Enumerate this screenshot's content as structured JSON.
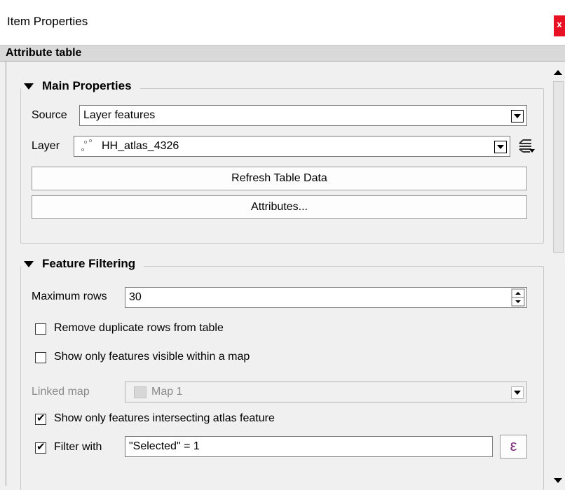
{
  "window": {
    "title": "Item Properties",
    "close_glyph": "x"
  },
  "section_header": "Attribute table",
  "main_properties": {
    "title": "Main Properties",
    "source_label": "Source",
    "source_value": "Layer features",
    "layer_label": "Layer",
    "layer_value": "HH_atlas_4326",
    "refresh_button": "Refresh Table Data",
    "attributes_button": "Attributes..."
  },
  "feature_filtering": {
    "title": "Feature Filtering",
    "max_rows_label": "Maximum rows",
    "max_rows_value": "30",
    "remove_duplicates_label": "Remove duplicate rows from table",
    "remove_duplicates_checked": false,
    "visible_in_map_label": "Show only features visible within a map",
    "visible_in_map_checked": false,
    "linked_map_label": "Linked map",
    "linked_map_value": "Map 1",
    "intersect_atlas_label": "Show only features intersecting atlas feature",
    "intersect_atlas_checked": true,
    "filter_with_label": "Filter with",
    "filter_with_checked": true,
    "filter_expression": "\"Selected\"  = 1",
    "expression_button_glyph": "ε"
  }
}
